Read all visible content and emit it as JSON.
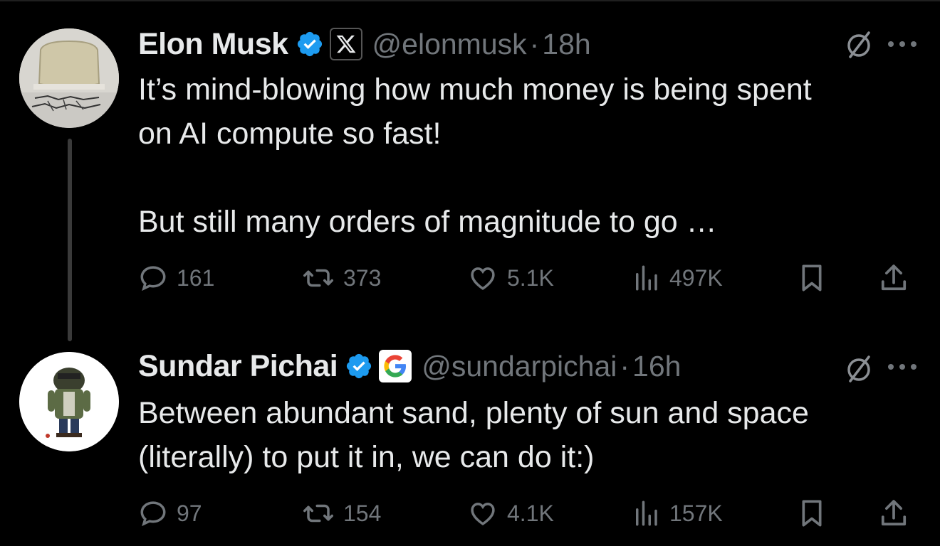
{
  "tweets": [
    {
      "name": "Elon Musk",
      "handle": "@elonmusk",
      "separator": "·",
      "time": "18h",
      "affiliation": "X",
      "lines": [
        "It’s mind-blowing how much money is being spent",
        "on AI compute so fast!",
        "",
        "But still many orders of magnitude to go …"
      ],
      "stats": {
        "replies": "161",
        "reposts": "373",
        "likes": "5.1K",
        "views": "497K"
      }
    },
    {
      "name": "Sundar Pichai",
      "handle": "@sundarpichai",
      "separator": "·",
      "time": "16h",
      "affiliation": "G",
      "lines": [
        "Between abundant sand, plenty of sun and space",
        "(literally) to put it in, we can do it:)"
      ],
      "stats": {
        "replies": "97",
        "reposts": "154",
        "likes": "4.1K",
        "views": "157K"
      }
    }
  ],
  "colors": {
    "background": "#000000",
    "text": "#e7e9ea",
    "muted": "#71767b",
    "verified": "#1d9bf0"
  },
  "icons": [
    "verified-badge-icon",
    "x-logo-icon",
    "google-logo-icon",
    "grok-icon",
    "more-icon",
    "reply-icon",
    "repost-icon",
    "like-icon",
    "views-icon",
    "bookmark-icon",
    "share-icon"
  ]
}
